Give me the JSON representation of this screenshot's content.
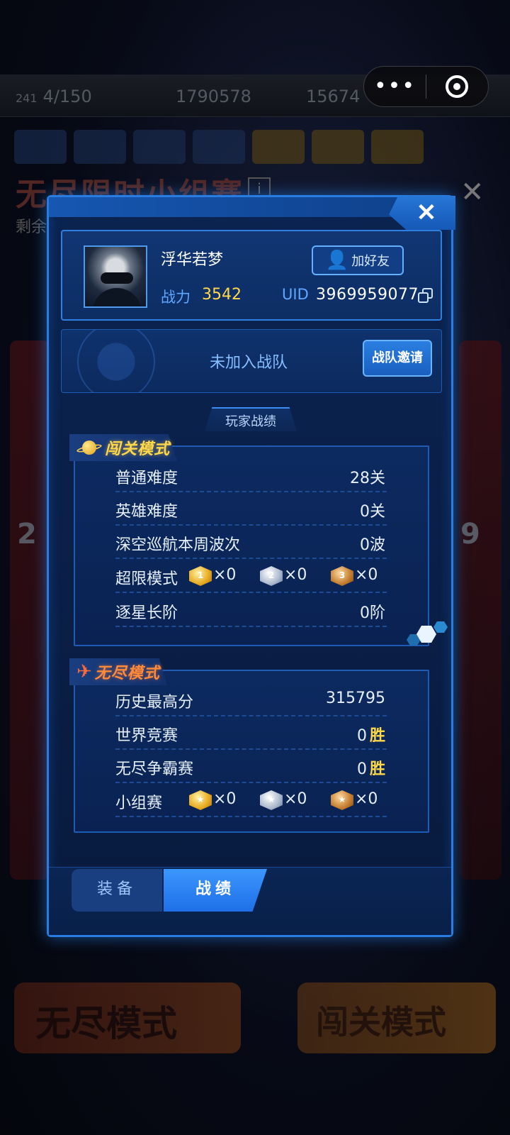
{
  "background": {
    "stats": [
      {
        "prefix": "241",
        "value": "4/150"
      },
      {
        "value": "1790578"
      },
      {
        "value": "15674"
      }
    ],
    "title": "无尽限时小组赛",
    "title_info": "i",
    "subtitle": "剩余",
    "left_digit": "2",
    "right_digit": "9",
    "bottom_left_button": "无尽模式",
    "bottom_right_button": "闯关模式"
  },
  "capsule": {
    "more_icon": "more-dots-icon",
    "target_icon": "close-target-icon",
    "more_label": "•••"
  },
  "modal": {
    "close_label": "✕",
    "profile": {
      "name": "浮华若梦",
      "power_label": "战力",
      "power_value": "3542",
      "add_friend_label": "加好友",
      "uid_label": "UID",
      "uid_value": "3969959077"
    },
    "team": {
      "status": "未加入战队",
      "invite_label": "战队邀请"
    },
    "stats_heading": "玩家战绩",
    "campaign": {
      "title": "闯关模式",
      "rows": [
        {
          "label": "普通难度",
          "value": "28关"
        },
        {
          "label": "英雄难度",
          "value": "0关"
        },
        {
          "label": "深空巡航本周波次",
          "value": "0波"
        }
      ],
      "limit_label": "超限模式",
      "limit_badges": [
        {
          "tier": "1",
          "count": "×0",
          "color": "gold"
        },
        {
          "tier": "2",
          "count": "×0",
          "color": "silver"
        },
        {
          "tier": "3",
          "count": "×0",
          "color": "bronze"
        }
      ],
      "star_label": "逐星长阶",
      "star_value": "0阶"
    },
    "endless": {
      "title": "无尽模式",
      "high_score_label": "历史最高分",
      "high_score_value": "315795",
      "world_label": "世界竞赛",
      "world_value": "0",
      "world_suffix": "胜",
      "endless_label": "无尽争霸赛",
      "endless_value": "0",
      "endless_suffix": "胜",
      "group_label": "小组赛",
      "group_badges": [
        {
          "count": "×0",
          "color": "gold"
        },
        {
          "count": "×0",
          "color": "silver"
        },
        {
          "count": "×0",
          "color": "bronze"
        }
      ]
    },
    "tabs": {
      "equipment": "装备",
      "records": "战绩"
    }
  },
  "colors": {
    "panel_border": "#2a7de0",
    "gold_text": "#ffd84a",
    "accent_blue": "#5fa7ff"
  }
}
